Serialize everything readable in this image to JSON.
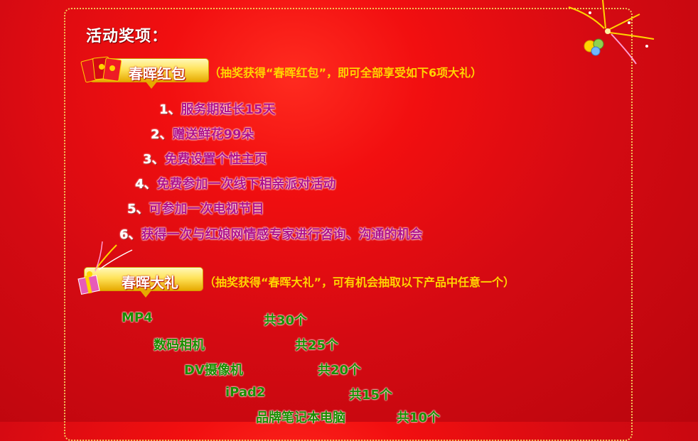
{
  "section_title": "活动奖项：",
  "red_packet": {
    "tag": "春晖红包",
    "desc": "（抽奖获得“春晖红包”，即可全部享受如下6项大礼）",
    "items": [
      {
        "num": "1、",
        "text": "服务期延长15天"
      },
      {
        "num": "2、",
        "text": "赠送鲜花99朵"
      },
      {
        "num": "3、",
        "text": "免费设置个性主页"
      },
      {
        "num": "4、",
        "text": "免费参加一次线下相亲派对活动"
      },
      {
        "num": "5、",
        "text": "可参加一次电视节目"
      },
      {
        "num": "6、",
        "text": "获得一次与红娘网情感专家进行咨询、沟通的机会"
      }
    ]
  },
  "gift": {
    "tag": "春晖大礼",
    "desc": "（抽奖获得“春晖大礼”，可有机会抽取以下产品中任意一个）",
    "prizes": [
      {
        "name": "MP4",
        "count": "共30个"
      },
      {
        "name": "数码相机",
        "count": "共25个"
      },
      {
        "name": "DV摄像机",
        "count": "共20个"
      },
      {
        "name": "iPad2",
        "count": "共15个"
      },
      {
        "name": "品牌笔记本电脑",
        "count": "共10个"
      }
    ]
  },
  "colors": {
    "background": "#d40a12",
    "tag_gold": "#ffe35a",
    "desc_yellow": "#ffd400",
    "item_purple": "#b0118b",
    "prize_green": "#1a8e00"
  },
  "icons": [
    "red-envelope-icon",
    "gift-box-icon",
    "firework-icon",
    "balloon-icon"
  ]
}
